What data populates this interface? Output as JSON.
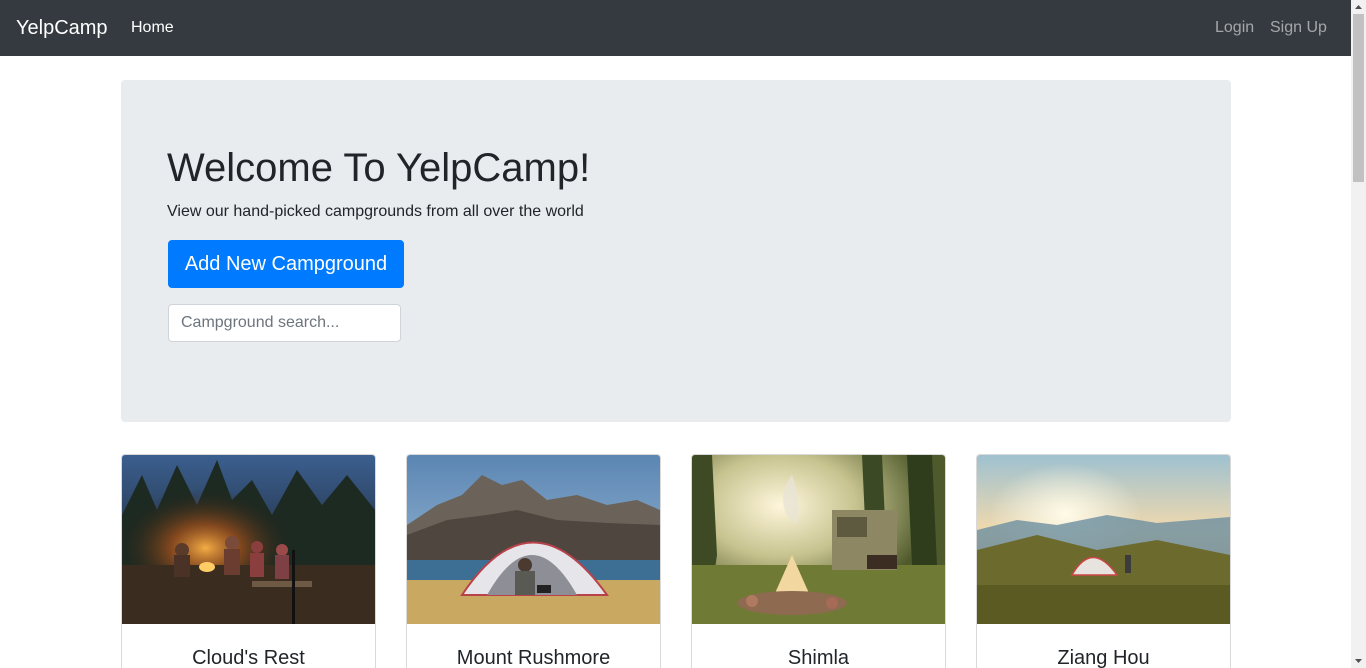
{
  "navbar": {
    "brand": "YelpCamp",
    "home": "Home",
    "login": "Login",
    "signup": "Sign Up"
  },
  "jumbotron": {
    "title": "Welcome To YelpCamp!",
    "subtitle": "View our hand-picked campgrounds from all over the world",
    "add_button": "Add New Campground",
    "search_placeholder": "Campground search..."
  },
  "campgrounds": [
    {
      "name": "Cloud's Rest",
      "image": "campfire-at-night-photo"
    },
    {
      "name": "Mount Rushmore",
      "image": "tent-by-lake-photo"
    },
    {
      "name": "Shimla",
      "image": "campfire-trailer-forest-photo"
    },
    {
      "name": "Ziang Hou",
      "image": "tent-mountain-sunset-photo"
    }
  ],
  "colors": {
    "navbar_bg": "#343a40",
    "jumbotron_bg": "#e9ecef",
    "primary": "#007bff"
  }
}
